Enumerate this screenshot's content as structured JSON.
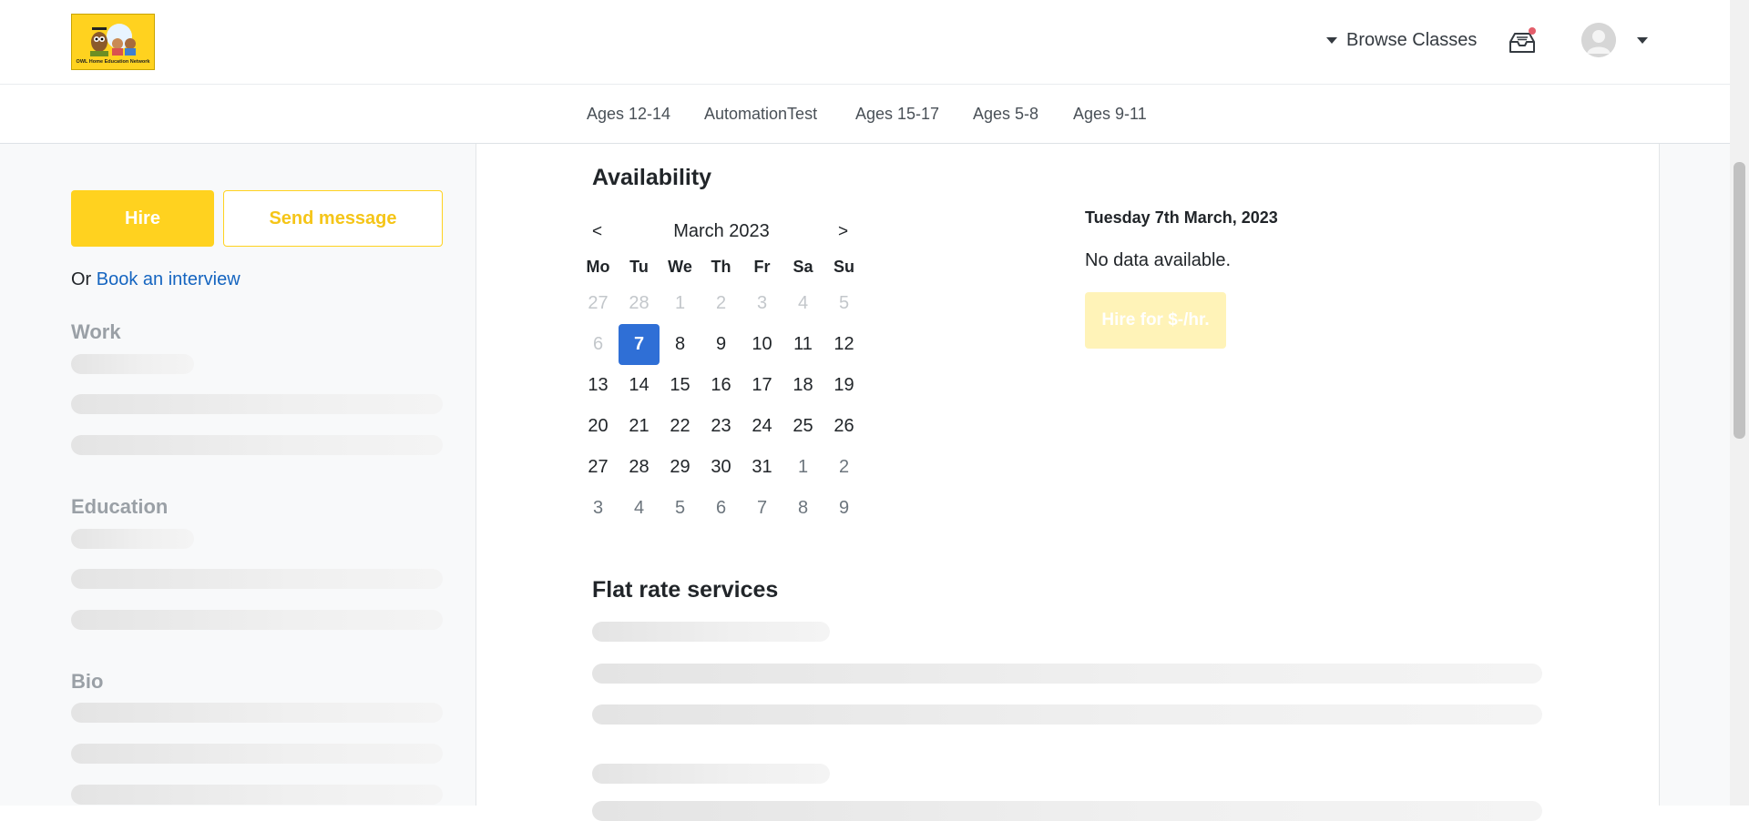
{
  "header": {
    "logo_text": "OWL Home Education Network",
    "browse_label": "Browse Classes"
  },
  "categories": [
    "Ages 12-14",
    "AutomationTest",
    "Ages 15-17",
    "Ages 5-8",
    "Ages 9-11"
  ],
  "sidebar": {
    "hire_label": "Hire",
    "message_label": "Send message",
    "or_text": "Or",
    "interview_link": "Book an interview",
    "sections": [
      "Work",
      "Education",
      "Bio"
    ]
  },
  "availability": {
    "title": "Availability",
    "prev": "<",
    "next": ">",
    "month_label": "March 2023",
    "weekdays": [
      "Mo",
      "Tu",
      "We",
      "Th",
      "Fr",
      "Sa",
      "Su"
    ],
    "weeks": [
      [
        "27",
        "28",
        "1",
        "2",
        "3",
        "4",
        "5"
      ],
      [
        "6",
        "7",
        "8",
        "9",
        "10",
        "11",
        "12"
      ],
      [
        "13",
        "14",
        "15",
        "16",
        "17",
        "18",
        "19"
      ],
      [
        "20",
        "21",
        "22",
        "23",
        "24",
        "25",
        "26"
      ],
      [
        "27",
        "28",
        "29",
        "30",
        "31",
        "1",
        "2"
      ],
      [
        "3",
        "4",
        "5",
        "6",
        "7",
        "8",
        "9"
      ]
    ],
    "selected_date": "Tuesday 7th March, 2023",
    "no_data": "No data available.",
    "hire_rate_label": "Hire for $-/hr."
  },
  "flat_rate": {
    "title": "Flat rate services"
  },
  "colors": {
    "brand_yellow": "#ffd21f",
    "link_blue": "#1565c0",
    "selected_day": "#2f6fd6",
    "notification": "#e35d6a"
  }
}
